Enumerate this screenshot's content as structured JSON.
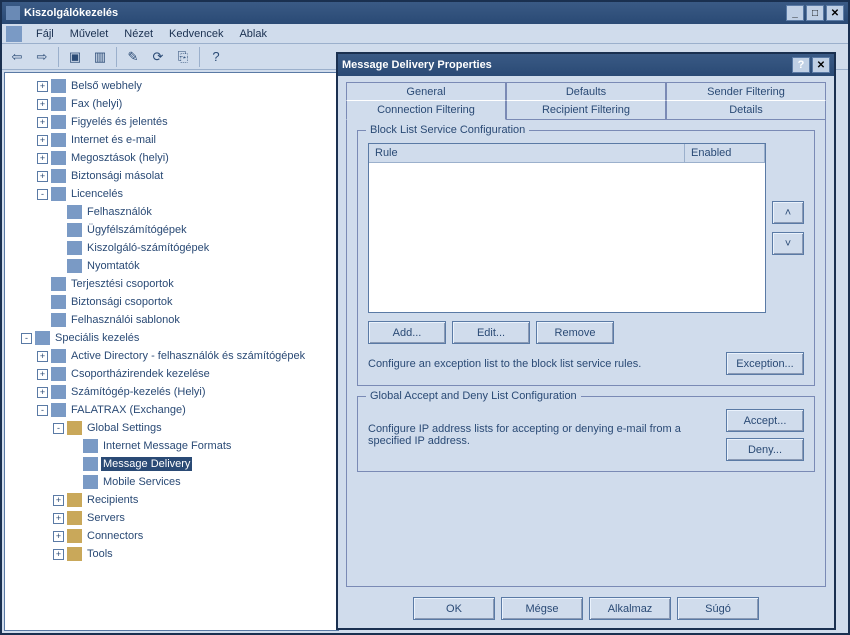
{
  "main": {
    "title": "Kiszolgálókezelés",
    "menu": [
      "Fájl",
      "Művelet",
      "Nézet",
      "Kedvencek",
      "Ablak"
    ],
    "toolbar_icons": [
      "back",
      "forward",
      "up",
      "toggle",
      "sep",
      "prop",
      "refresh",
      "export",
      "sep",
      "help"
    ]
  },
  "tree": [
    {
      "depth": 2,
      "toggle": "+",
      "icon": "web",
      "label": "Belső webhely"
    },
    {
      "depth": 2,
      "toggle": "+",
      "icon": "fax",
      "label": "Fax (helyi)"
    },
    {
      "depth": 2,
      "toggle": "+",
      "icon": "mon",
      "label": "Figyelés és jelentés"
    },
    {
      "depth": 2,
      "toggle": "+",
      "icon": "mail",
      "label": "Internet és e-mail"
    },
    {
      "depth": 2,
      "toggle": "+",
      "icon": "share",
      "label": "Megosztások (helyi)"
    },
    {
      "depth": 2,
      "toggle": "+",
      "icon": "backup",
      "label": "Biztonsági másolat"
    },
    {
      "depth": 2,
      "toggle": "-",
      "icon": "lic",
      "label": "Licencelés"
    },
    {
      "depth": 3,
      "toggle": "",
      "icon": "user",
      "label": "Felhasználók"
    },
    {
      "depth": 3,
      "toggle": "",
      "icon": "pc",
      "label": "Ügyfélszámítógépek"
    },
    {
      "depth": 3,
      "toggle": "",
      "icon": "srv",
      "label": "Kiszolgáló-számítógépek"
    },
    {
      "depth": 3,
      "toggle": "",
      "icon": "prn",
      "label": "Nyomtatók"
    },
    {
      "depth": 2,
      "toggle": "",
      "icon": "grp",
      "label": "Terjesztési csoportok"
    },
    {
      "depth": 2,
      "toggle": "",
      "icon": "sec",
      "label": "Biztonsági csoportok"
    },
    {
      "depth": 2,
      "toggle": "",
      "icon": "tpl",
      "label": "Felhasználói sablonok"
    },
    {
      "depth": 1,
      "toggle": "-",
      "icon": "adv",
      "label": "Speciális kezelés"
    },
    {
      "depth": 2,
      "toggle": "+",
      "icon": "ad",
      "label": "Active Directory - felhasználók és számítógépek"
    },
    {
      "depth": 2,
      "toggle": "+",
      "icon": "gpo",
      "label": "Csoportházirendek kezelése"
    },
    {
      "depth": 2,
      "toggle": "+",
      "icon": "cmp",
      "label": "Számítógép-kezelés (Helyi)"
    },
    {
      "depth": 2,
      "toggle": "-",
      "icon": "ex",
      "label": "FALATRAX (Exchange)"
    },
    {
      "depth": 3,
      "toggle": "-",
      "icon": "folder",
      "label": "Global Settings"
    },
    {
      "depth": 4,
      "toggle": "",
      "icon": "msg",
      "label": "Internet Message Formats"
    },
    {
      "depth": 4,
      "toggle": "",
      "icon": "msg",
      "label": "Message Delivery",
      "selected": true
    },
    {
      "depth": 4,
      "toggle": "",
      "icon": "msg",
      "label": "Mobile Services"
    },
    {
      "depth": 3,
      "toggle": "+",
      "icon": "folder",
      "label": "Recipients"
    },
    {
      "depth": 3,
      "toggle": "+",
      "icon": "folder",
      "label": "Servers"
    },
    {
      "depth": 3,
      "toggle": "+",
      "icon": "folder",
      "label": "Connectors"
    },
    {
      "depth": 3,
      "toggle": "+",
      "icon": "folder",
      "label": "Tools"
    }
  ],
  "dialog": {
    "title": "Message Delivery Properties",
    "tabs_back": [
      "General",
      "Defaults",
      "Sender Filtering"
    ],
    "tabs_front": [
      "Connection Filtering",
      "Recipient Filtering",
      "Details"
    ],
    "active_tab": "Connection Filtering",
    "group1": {
      "title": "Block List Service Configuration",
      "cols": [
        "Rule",
        "Enabled"
      ],
      "buttons": [
        "Add...",
        "Edit...",
        "Remove"
      ],
      "exception_text": "Configure an exception list to the block list service rules.",
      "exception_btn": "Exception..."
    },
    "group2": {
      "title": "Global Accept and Deny List Configuration",
      "text": "Configure IP address lists for accepting or denying e-mail from a specified IP address.",
      "accept_btn": "Accept...",
      "deny_btn": "Deny..."
    },
    "footer": [
      "OK",
      "Mégse",
      "Alkalmaz",
      "Súgó"
    ]
  }
}
